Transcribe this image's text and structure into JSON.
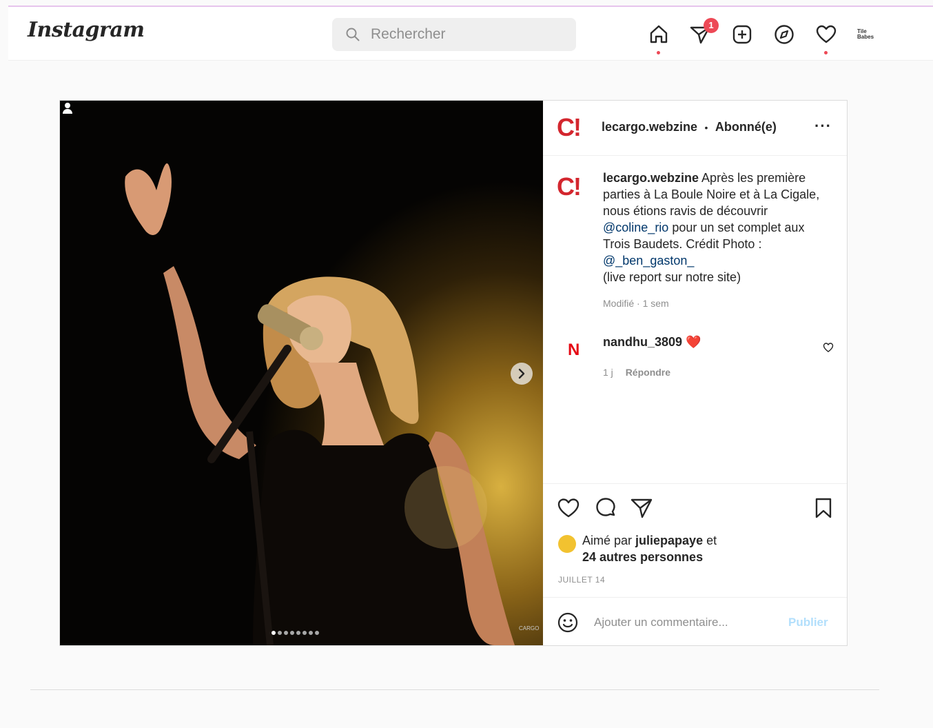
{
  "header": {
    "logo": "Instagram",
    "search_placeholder": "Rechercher",
    "notification_count": "1",
    "avatar_text": "Tile Babes"
  },
  "post": {
    "account": "lecargo.webzine",
    "separator": "•",
    "follow_status": "Abonné(e)",
    "more": "···",
    "brand_logo": "C!",
    "caption": {
      "username": "lecargo.webzine",
      "line1": " Après les première parties à La Boule Noire et à La Cigale, nous étions ravis de découvrir ",
      "mention1": "@coline_rio",
      "line2": " pour un set complet aux Trois Baudets. Crédit Photo : ",
      "mention2": "@_ben_gaston_",
      "line3": "(live report sur notre site)",
      "meta": "Modifié · 1 sem"
    },
    "comment": {
      "avatar_letter": "N",
      "username": "nandhu_3809",
      "text": "❤️",
      "time": "1 j",
      "reply": "Répondre"
    },
    "likes": {
      "prefix": "Aimé par ",
      "user": "juliepapaye",
      "suffix": " et",
      "others": "24 autres personnes"
    },
    "date": "JUILLET 14",
    "add_comment_placeholder": "Ajouter un commentaire...",
    "publish": "Publier",
    "carousel": {
      "total": 8,
      "active": 1
    },
    "watermark": "CARGO"
  },
  "colors": {
    "brand_red": "#d3262e",
    "notification": "#ed4956",
    "link": "#00376b",
    "publish_disabled": "#b2dffc"
  },
  "icons": [
    "search-icon",
    "home-icon",
    "direct-icon",
    "new-post-icon",
    "explore-icon",
    "activity-heart-icon",
    "like-icon",
    "comment-icon",
    "share-icon",
    "bookmark-icon",
    "emoji-icon",
    "chevron-right-icon",
    "user-tag-icon"
  ]
}
